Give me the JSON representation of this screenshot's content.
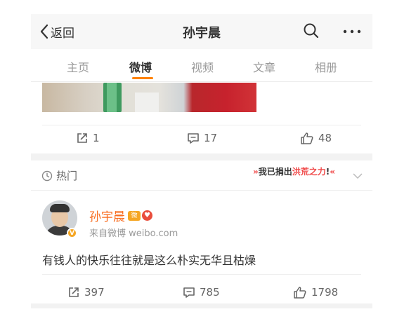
{
  "header": {
    "back_label": "返回",
    "title": "孙宇晨"
  },
  "tabs": [
    {
      "label": "主页",
      "active": false
    },
    {
      "label": "微博",
      "active": true
    },
    {
      "label": "视频",
      "active": false
    },
    {
      "label": "文章",
      "active": false
    },
    {
      "label": "相册",
      "active": false
    }
  ],
  "post1": {
    "reposts": "1",
    "comments": "17",
    "likes": "48"
  },
  "hot_section": {
    "label": "热门",
    "promo_prefix": "我已捐出",
    "promo_highlight": "洪荒之力",
    "promo_suffix": "!",
    "promo_arrows_left": "»",
    "promo_arrows_right": "«"
  },
  "post2": {
    "author": "孙宇晨",
    "verified_badge": "V",
    "badge1": "微",
    "badge2": "♥",
    "source": "来自微博 weibo.com",
    "text": "有钱人的快乐往往就是这么朴实无华且枯燥",
    "reposts": "397",
    "comments": "785",
    "likes": "1798"
  },
  "colors": {
    "accent": "#ff8200",
    "username": "#f86b1d",
    "verified": "#f5a623"
  },
  "icons": [
    "chevron-left-icon",
    "search-icon",
    "more-icon",
    "repost-icon",
    "comment-icon",
    "like-icon",
    "clock-icon",
    "chevron-down-icon"
  ]
}
